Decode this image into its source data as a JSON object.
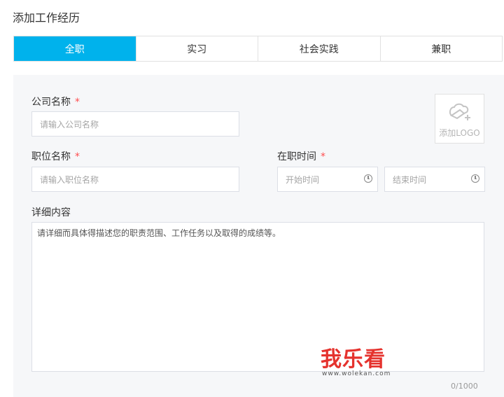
{
  "page": {
    "title": "添加工作经历"
  },
  "tabs": [
    {
      "label": "全职",
      "active": true
    },
    {
      "label": "实习",
      "active": false
    },
    {
      "label": "社会实践",
      "active": false
    },
    {
      "label": "兼职",
      "active": false
    }
  ],
  "form": {
    "company": {
      "label": "公司名称",
      "required_mark": "*",
      "placeholder": "请输入公司名称"
    },
    "position": {
      "label": "职位名称",
      "required_mark": "*",
      "placeholder": "请输入职位名称"
    },
    "tenure": {
      "label": "在职时间",
      "required_mark": "*",
      "start_placeholder": "开始时间",
      "end_placeholder": "结束时间",
      "icon": "clock-icon"
    },
    "details": {
      "label": "详细内容",
      "placeholder": "请详细而具体得描述您的职责范围、工作任务以及取得的成绩等。"
    },
    "logo": {
      "label": "添加LOGO",
      "icon": "logo-upload-icon"
    },
    "counter": "0/1000"
  },
  "watermark": {
    "text": "我乐看",
    "url": "www.wolekan.com"
  },
  "colors": {
    "accent": "#00b2ec",
    "required": "#ff4d4f",
    "panel_bg": "#f6f7f9",
    "watermark": "#e5322d"
  }
}
